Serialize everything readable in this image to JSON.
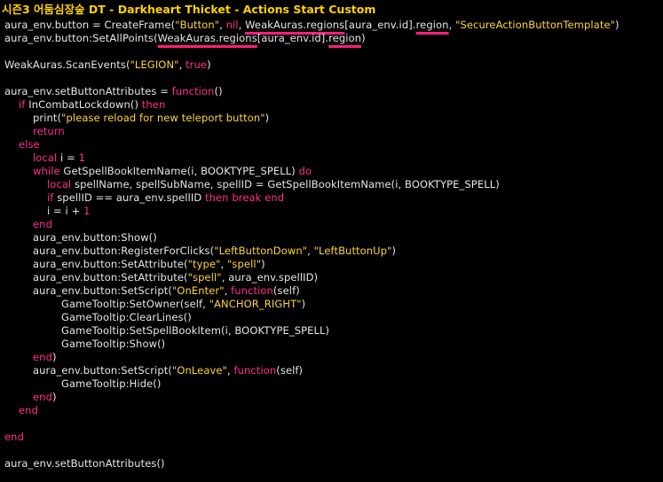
{
  "window": {
    "title": "시즌3 어둠심장숲 DT - Darkheart Thicket - Actions Start Custom"
  },
  "code": {
    "l1": [
      "aura_env.button = CreateFrame(",
      "\"Button\"",
      ", ",
      "nil",
      ", ",
      "WeakAuras.regions",
      "[aura_env.id].",
      "region",
      ", ",
      "\"SecureActionButtonTemplate\"",
      ")"
    ],
    "l2": [
      "aura_env.button:SetAllPoints(",
      "WeakAuras.regions",
      "[aura_env.id].",
      "region",
      ")"
    ],
    "l4": [
      "WeakAuras.ScanEvents(",
      "\"LEGION\"",
      ", ",
      "true",
      ")"
    ],
    "l6": [
      "aura_env.setButtonAttributes = ",
      "function",
      "()"
    ],
    "l7": [
      "if",
      " InCombatLockdown() ",
      "then"
    ],
    "l8": [
      "print(",
      "\"please reload for new teleport button\"",
      ")"
    ],
    "l9": [
      "return"
    ],
    "l10": [
      "else"
    ],
    "l11": [
      "local",
      " i = ",
      "1"
    ],
    "l12": [
      "while",
      " GetSpellBookItemName(i, BOOKTYPE_SPELL) ",
      "do"
    ],
    "l13": [
      "local",
      " spellName, spellSubName, spellID = GetSpellBookItemName(i, BOOKTYPE_SPELL)"
    ],
    "l14": [
      "if",
      " spellID == aura_env.spellID ",
      "then",
      " ",
      "break",
      " ",
      "end"
    ],
    "l15": [
      "i = i + ",
      "1"
    ],
    "l16": [
      "end"
    ],
    "l17": [
      "aura_env.button:Show()"
    ],
    "l18": [
      "aura_env.button:RegisterForClicks(",
      "\"LeftButtonDown\"",
      ", ",
      "\"LeftButtonUp\"",
      ")"
    ],
    "l19": [
      "aura_env.button:SetAttribute(",
      "\"type\"",
      ", ",
      "\"spell\"",
      ")"
    ],
    "l20": [
      "aura_env.button:SetAttribute(",
      "\"spell\"",
      ", aura_env.spellID)"
    ],
    "l21": [
      "aura_env.button:SetScript(",
      "\"OnEnter\"",
      ", ",
      "function",
      "(self)"
    ],
    "l22": [
      "GameTooltip:SetOwner(self, ",
      "\"ANCHOR_RIGHT\"",
      ")"
    ],
    "l23": [
      "GameTooltip:ClearLines()"
    ],
    "l24": [
      "GameTooltip:SetSpellBookItem(i, BOOKTYPE_SPELL)"
    ],
    "l25": [
      "GameTooltip:Show()"
    ],
    "l26": [
      "end",
      ")"
    ],
    "l27": [
      "aura_env.button:SetScript(",
      "\"OnLeave\"",
      ", ",
      "function",
      "(self)"
    ],
    "l28": [
      "GameTooltip:Hide()"
    ],
    "l29": [
      "end",
      ")"
    ],
    "l30": [
      "end"
    ],
    "l32": [
      "end"
    ],
    "l34": [
      "aura_env.setButtonAttributes()"
    ]
  }
}
